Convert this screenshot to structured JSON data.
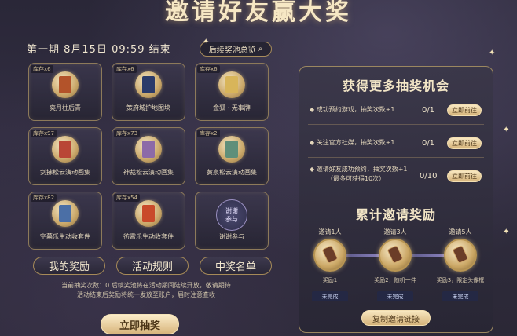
{
  "header": {
    "title": "邀请好友赢大奖",
    "period": "第一期 8月15日 09:59 结束",
    "pool_button": "后续奖池总览"
  },
  "prizes": [
    {
      "stock": "库存x6",
      "name": "奕月柱后青",
      "color": "#b3532a"
    },
    {
      "stock": "库存x6",
      "name": "策府城护地图块",
      "color": "#2b3b6a"
    },
    {
      "stock": "库存x6",
      "name": "金狐 · 无事牌",
      "color": "#d8b55a"
    },
    {
      "stock": "库存x97",
      "name": "剑拂松云演动画集",
      "color": "#b94636"
    },
    {
      "stock": "库存x73",
      "name": "神裁松云演动画集",
      "color": "#8c6aa8"
    },
    {
      "stock": "库存x2",
      "name": "黄泉松云演动画集",
      "color": "#5f8f7a"
    },
    {
      "stock": "库存x82",
      "name": "空幕乐生动收套件",
      "color": "#4b6fa6"
    },
    {
      "stock": "库存x54",
      "name": "彷霄乐生动收套件",
      "color": "#c94a2a"
    }
  ],
  "join_card": {
    "label": "谢谢参与",
    "circle_text": "谢谢\n参与"
  },
  "bottom_buttons": {
    "my_prizes": "我的奖励",
    "rules": "活动规则",
    "winners": "中奖名单"
  },
  "notice": "当前抽奖次数：0 后续奖池将在活动期间陆续开放，敬请期待\n活动结束后奖励将统一发放至账户，届时注意查收",
  "draw_button": "立即抽奖",
  "chances": {
    "title": "获得更多抽奖机会",
    "tasks": [
      {
        "text": "成功预约游戏，抽奖次数+1",
        "count": "0/1",
        "button": "立即前往"
      },
      {
        "text": "关注官方社媒，抽奖次数+1",
        "count": "0/1",
        "button": "立即前往"
      },
      {
        "text": "邀请好友成功预约，抽奖次数+1",
        "sub": "（最多可获得10次）",
        "count": "0/10",
        "button": "立即前往"
      }
    ]
  },
  "cumulative": {
    "title": "累计邀请奖励",
    "tiers": [
      {
        "label": "邀请1人",
        "reward": "奖励1",
        "status": "未完成"
      },
      {
        "label": "邀请3人",
        "reward": "奖励2，随机一件",
        "status": "未完成"
      },
      {
        "label": "邀请5人",
        "reward": "奖励3，限定头像框",
        "status": "未完成"
      }
    ],
    "copy_button": "复制邀请链接"
  }
}
